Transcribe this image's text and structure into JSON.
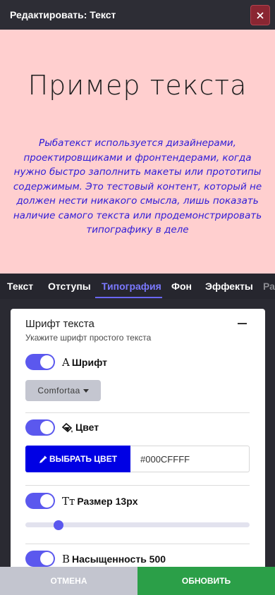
{
  "header": {
    "title": "Редактировать: Текст",
    "close_icon": "close-icon"
  },
  "preview": {
    "heading": "Пример текста",
    "body": "Рыбатекст используется дизайнерами, проектировщиками и фронтендерами, когда нужно быстро заполнить макеты или прототипы содержимым. Это тестовый контент, который не должен нести никакого смысла, лишь показать наличие самого текста или продемонстрировать типографику в деле",
    "background_color": "#ffcfcf",
    "text_color": "#2e1bd7"
  },
  "tabs": [
    {
      "label": "Текст"
    },
    {
      "label": "Отступы"
    },
    {
      "label": "Типография",
      "active": true
    },
    {
      "label": "Фон"
    },
    {
      "label": "Эффекты"
    },
    {
      "label": "Ра"
    }
  ],
  "typography": {
    "section_title": "Шрифт текста",
    "section_subtitle": "Укажите шрифт простого текста",
    "font": {
      "label": "Шрифт",
      "enabled": true,
      "value": "Comfortaa"
    },
    "color": {
      "label": "Цвет",
      "enabled": true,
      "pick_label": "ВЫБРАТЬ ЦВЕТ",
      "value": "#000CFFFF",
      "swatch": "#0000e4"
    },
    "size": {
      "label": "Размер 13px",
      "enabled": true,
      "slider_fraction": 0.11
    },
    "weight": {
      "label": "Насыщенность 500",
      "enabled": true
    }
  },
  "footer": {
    "cancel_label": "ОТМЕНА",
    "update_label": "ОБНОВИТЬ"
  },
  "colors": {
    "accent": "#5b58ee",
    "active_tab": "#7b79ff",
    "update": "#2b9f48",
    "cancel": "#c3c5cf"
  }
}
